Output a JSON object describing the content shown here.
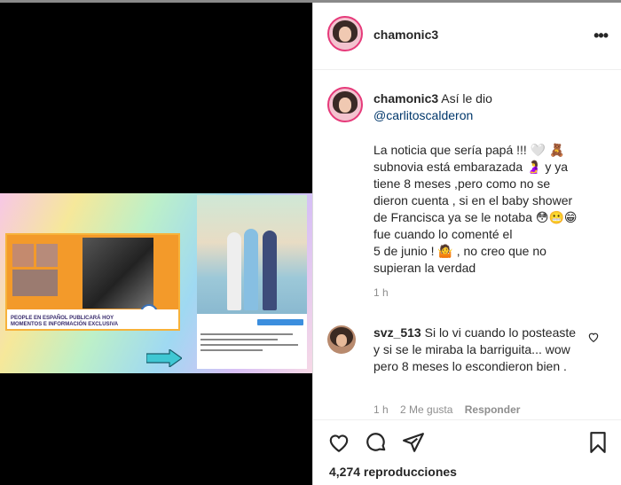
{
  "header": {
    "username": "chamonic3",
    "more_icon": "more-options-icon"
  },
  "media": {
    "tv_lower_line1": "PEOPLE EN ESPAÑOL PUBLICARÁ HOY",
    "tv_lower_line2": "MOMENTOS E INFORMACIÓN EXCLUSIVA"
  },
  "caption": {
    "username": "chamonic3",
    "intro": "Así le dio",
    "mention": "@carlitoscalderon",
    "body": "La noticia que sería papá !!! 🤍 🧸\nsubnovia está embarazada 🤰 y ya\ntiene 8 meses ,pero como no se\ndieron cuenta , si en el baby shower\nde Francisca ya se le notaba 😳😬😁\nfue cuando lo comenté el\n5 de junio ! 🤷 , no creo que no\nsupieran la verdad",
    "time": "1 h"
  },
  "comment": {
    "username": "svz_513",
    "text": "Si lo vi cuando lo posteaste y si se le miraba la barriguita... wow pero 8 meses lo escondieron bien .",
    "time": "1 h",
    "likes": "2 Me gusta",
    "reply": "Responder"
  },
  "actions": {
    "views": "4,274 reproducciones"
  },
  "colors": {
    "link": "#00376b",
    "secondary_text": "#8e8e8e",
    "avatar_ring": "#e63a7a"
  }
}
